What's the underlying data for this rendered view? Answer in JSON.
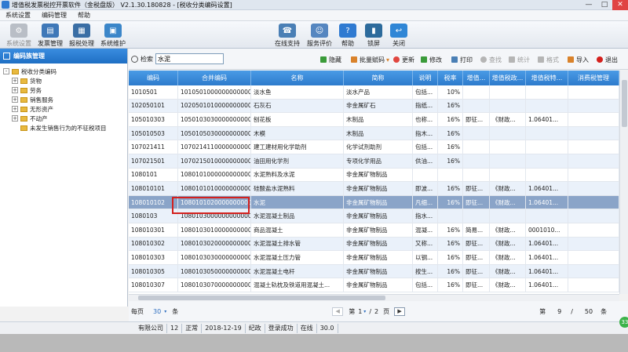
{
  "app": {
    "title": "增值税发票税控开票软件（金税盘版） V2.1.30.180828 - [税收分类编码设置]",
    "window_buttons": [
      "—",
      "□",
      "✕"
    ]
  },
  "menu": [
    "系统设置",
    "编码管理",
    "帮助"
  ],
  "toolbar": {
    "left": [
      {
        "label": "系统设置",
        "icon": "gear-icon",
        "enabled": false,
        "color": "#9aa3ad"
      },
      {
        "label": "发票管理",
        "icon": "invoice-icon",
        "enabled": true,
        "color": "#3f78b8"
      },
      {
        "label": "报税处理",
        "icon": "tax-report-icon",
        "enabled": true,
        "color": "#3a6ea5"
      },
      {
        "label": "系统维护",
        "icon": "maintenance-icon",
        "enabled": true,
        "color": "#3b86c9"
      }
    ],
    "right": [
      {
        "label": "在线支持",
        "icon": "support-icon",
        "color": "#4a7fb5"
      },
      {
        "label": "服务评价",
        "icon": "rating-icon",
        "color": "#5586c0"
      },
      {
        "label": "帮助",
        "icon": "help-icon",
        "color": "#2f7ad1"
      },
      {
        "label": "锁屏",
        "icon": "lock-screen-icon",
        "color": "#2d6b9c"
      },
      {
        "label": "关闭",
        "icon": "close-arrow-icon",
        "color": "#2f86d6"
      }
    ]
  },
  "left_panel": {
    "title": "编码族管理",
    "tree": [
      {
        "label": "税收分类编码",
        "level": 0,
        "expander": "-"
      },
      {
        "label": "货物",
        "level": 1,
        "expander": "+"
      },
      {
        "label": "劳务",
        "level": 1,
        "expander": "+"
      },
      {
        "label": "销售服务",
        "level": 1,
        "expander": "+"
      },
      {
        "label": "无形资产",
        "level": 1,
        "expander": "+"
      },
      {
        "label": "不动产",
        "level": 1,
        "expander": "+"
      },
      {
        "label": "未发生销售行为的不征税项目",
        "level": 1,
        "expander": ""
      }
    ]
  },
  "search": {
    "label": "检索",
    "value": "水泥"
  },
  "actions": [
    {
      "label": "隐藏",
      "icon": "hide-icon",
      "enabled": true,
      "color": "#3a9b3a"
    },
    {
      "label": "批量赋码",
      "icon": "batch-code-icon",
      "enabled": true,
      "color": "#d9822b",
      "dropdown": "▾"
    },
    {
      "label": "更新",
      "icon": "refresh-icon",
      "enabled": true,
      "color": "#e0463f"
    },
    {
      "label": "修改",
      "icon": "edit-icon",
      "enabled": true,
      "color": "#3a9b3a"
    },
    {
      "label": "打印",
      "icon": "print-icon",
      "enabled": true,
      "color": "#4a7fb5"
    },
    {
      "label": "查找",
      "icon": "find-icon",
      "enabled": false,
      "color": "#b5b5b5"
    },
    {
      "label": "统计",
      "icon": "stats-icon",
      "enabled": false,
      "color": "#b5b5b5"
    },
    {
      "label": "格式",
      "icon": "format-icon",
      "enabled": false,
      "color": "#b5b5b5"
    },
    {
      "label": "导入",
      "icon": "import-icon",
      "enabled": true,
      "color": "#d9822b"
    },
    {
      "label": "退出",
      "icon": "exit-icon",
      "enabled": true,
      "color": "#d4201d"
    }
  ],
  "grid": {
    "columns": [
      "编码",
      "合并编码",
      "名称",
      "简称",
      "说明",
      "税率",
      "增值...",
      "增值税政...",
      "增值税特...",
      "消费税管理"
    ],
    "rows": [
      [
        "1010501",
        "1010501000000000000",
        "淡水鱼",
        "淡水产品",
        "包括...",
        "10%",
        "",
        "",
        "",
        ""
      ],
      [
        "102050101",
        "1020501010000000000",
        "石灰石",
        "非金属矿石",
        "指纸...",
        "16%",
        "",
        "",
        "",
        ""
      ],
      [
        "105010303",
        "1050103030000000000",
        "刨花板",
        "木制品",
        "也称...",
        "16%",
        "即征...",
        "《财政...",
        "1.06401...",
        ""
      ],
      [
        "105010503",
        "1050105030000000000",
        "木模",
        "木制品",
        "指木...",
        "16%",
        "",
        "",
        "",
        ""
      ],
      [
        "107021411",
        "1070214110000000000",
        "建工建材用化学助剂",
        "化学试剂助剂",
        "包括...",
        "16%",
        "",
        "",
        "",
        ""
      ],
      [
        "107021501",
        "1070215010000000000",
        "油田用化学剂",
        "专项化学用品",
        "供油...",
        "16%",
        "",
        "",
        "",
        ""
      ],
      [
        "1080101",
        "1080101000000000000",
        "水泥熟料及水泥",
        "非金属矿物制品",
        "",
        "",
        "",
        "",
        "",
        ""
      ],
      [
        "108010101",
        "1080101010000000000",
        "硅酸盐水泥熟料",
        "非金属矿物制品",
        "即波...",
        "16%",
        "即征...",
        "《财政...",
        "1.06401...",
        ""
      ],
      [
        "108010102",
        "1080101020000000000",
        "水泥",
        "非金属矿物制品",
        "凡细...",
        "16%",
        "即征...",
        "《财政...",
        "1.06401...",
        ""
      ],
      [
        "1080103",
        "1080103000000000000",
        "水泥混凝土制品",
        "非金属矿物制品",
        "指水...",
        "",
        "",
        "",
        "",
        ""
      ],
      [
        "108010301",
        "1080103010000000000",
        "商品混凝土",
        "非金属矿物制品",
        "混凝...",
        "16%",
        "简易...",
        "《财政...",
        "0001010...",
        ""
      ],
      [
        "108010302",
        "1080103020000000000",
        "水泥混凝土排水管",
        "非金属矿物制品",
        "又称...",
        "16%",
        "即征...",
        "《财政...",
        "1.06401...",
        ""
      ],
      [
        "108010303",
        "1080103030000000000",
        "水泥混凝土压力管",
        "非金属矿物制品",
        "以钢...",
        "16%",
        "即征...",
        "《财政...",
        "1.06401...",
        ""
      ],
      [
        "108010305",
        "1080103050000000000",
        "水泥混凝土电杆",
        "非金属矿物制品",
        "按生...",
        "16%",
        "即征...",
        "《财政...",
        "1.06401...",
        ""
      ],
      [
        "108010307",
        "1080103070000000000",
        "混凝土轨枕及铁道用混凝土...",
        "非金属矿物制品",
        "包括...",
        "16%",
        "即征...",
        "《财政...",
        "1.06401...",
        ""
      ]
    ],
    "selected_row": 8
  },
  "pager": {
    "per_page_label": "每页",
    "per_page": "30",
    "per_page_unit": "条",
    "page": "1",
    "page_sep": "/",
    "pages": "2",
    "page_unit": "页",
    "record_label": "第",
    "record": "9",
    "record_sep": "/",
    "total": "50",
    "record_unit": "条",
    "nav": [
      "|◀",
      "◀",
      "▶",
      "▶|"
    ]
  },
  "statusbar": [
    "有限公司",
    "12",
    "正常",
    "2018-12-19",
    "纪政",
    "登录成功",
    "在线",
    "30.0"
  ],
  "badge": "33"
}
